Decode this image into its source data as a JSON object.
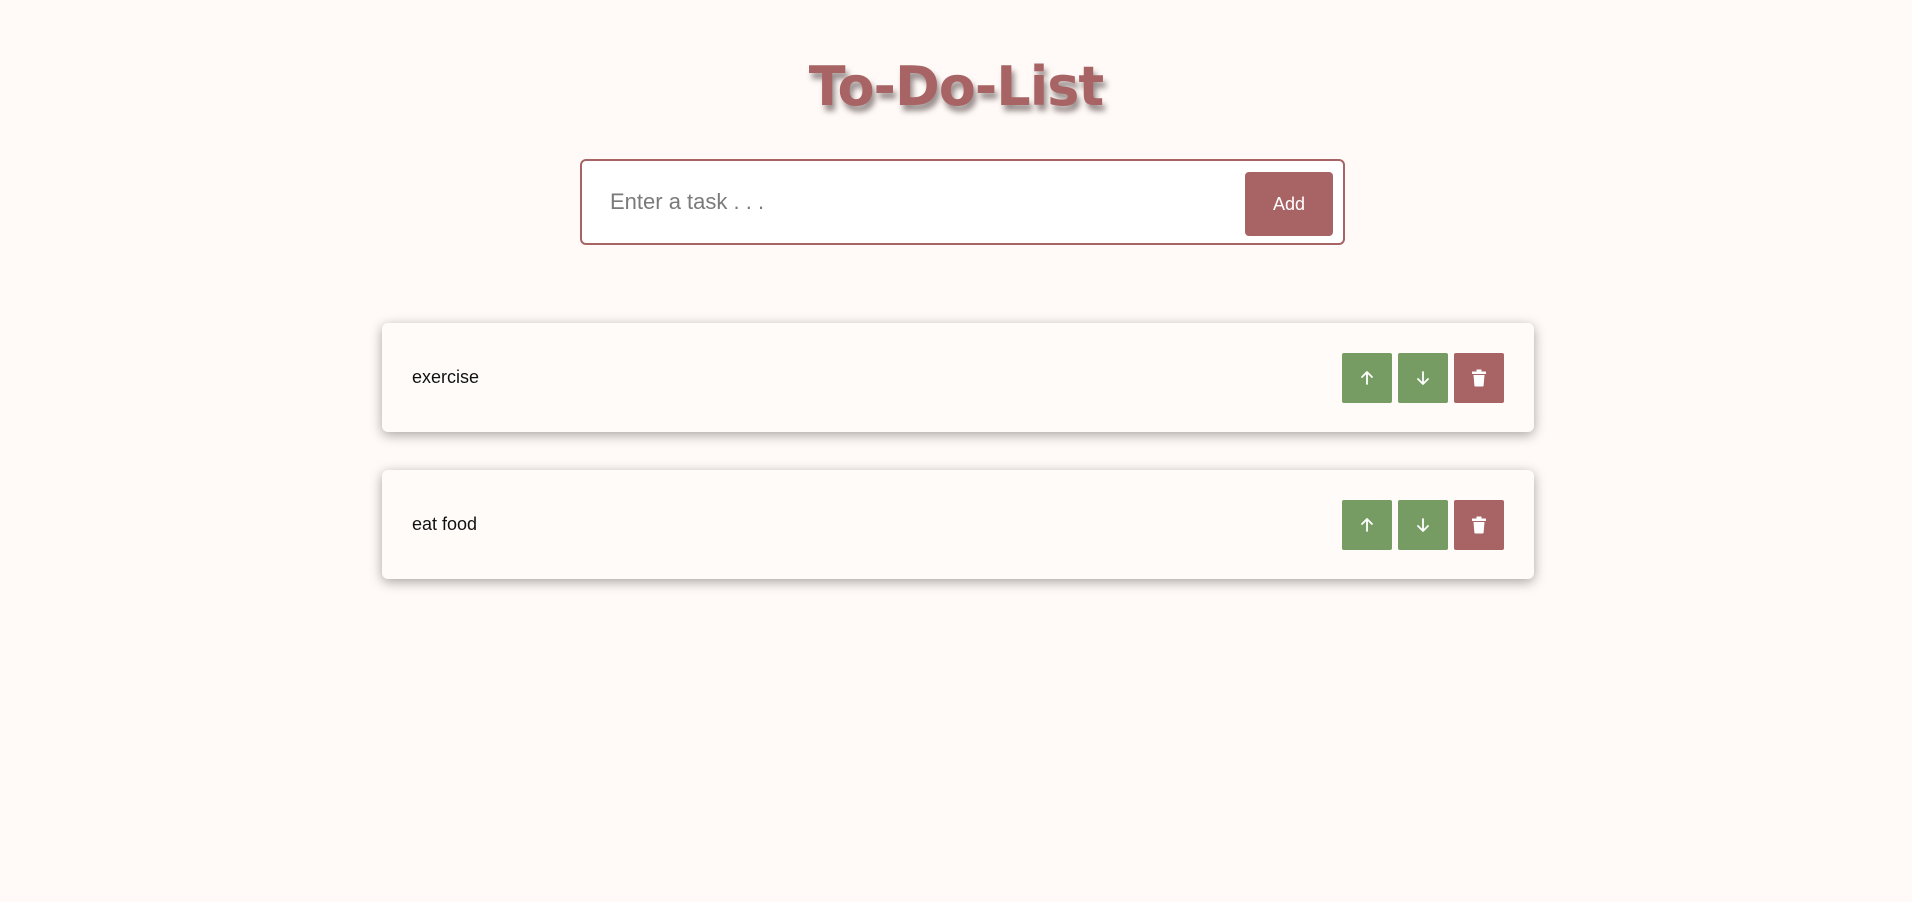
{
  "app": {
    "title": "To-Do-List"
  },
  "new_task": {
    "placeholder": "Enter a task . . .",
    "value": "",
    "add_label": "Add"
  },
  "tasks": [
    {
      "text": "exercise"
    },
    {
      "text": "eat food"
    }
  ],
  "icons": {
    "move_up": "arrow-up-icon",
    "move_down": "arrow-down-icon",
    "delete": "trash-icon"
  },
  "colors": {
    "accent": "#a86465",
    "move_button": "#769b63",
    "background": "#fffaf7"
  }
}
